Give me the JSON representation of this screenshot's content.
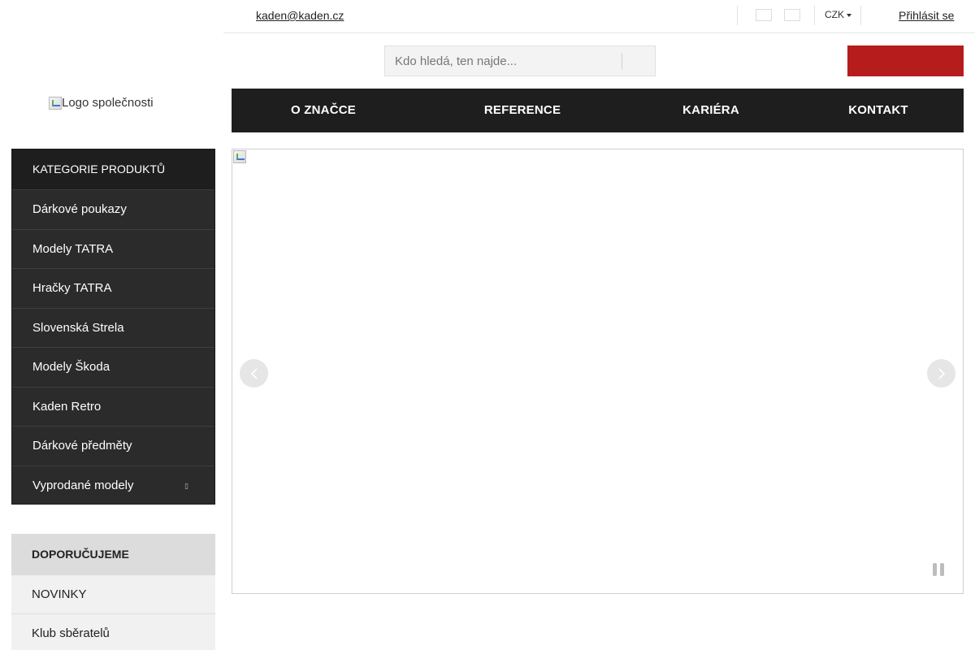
{
  "topbar": {
    "email": "kaden@kaden.cz",
    "currency": "CZK",
    "login": "Přihlásit se"
  },
  "logo": {
    "alt": "Logo společnosti"
  },
  "search": {
    "placeholder": "Kdo hledá, ten najde..."
  },
  "nav": {
    "items": [
      {
        "label": "O ZNAČCE"
      },
      {
        "label": "REFERENCE"
      },
      {
        "label": "KARIÉRA"
      },
      {
        "label": "KONTAKT"
      }
    ]
  },
  "categories": {
    "heading": "KATEGORIE PRODUKTŮ",
    "items": [
      {
        "label": "Dárkové poukazy"
      },
      {
        "label": "Modely TATRA"
      },
      {
        "label": "Hračky TATRA"
      },
      {
        "label": "Slovenská Strela"
      },
      {
        "label": "Modely Škoda"
      },
      {
        "label": "Kaden Retro"
      },
      {
        "label": "Dárkové předměty"
      },
      {
        "label": "Vyprodané modely"
      }
    ],
    "expand_icon": "expand-icon"
  },
  "recommend": {
    "heading": "DOPORUČUJEME",
    "items": [
      {
        "label": "NOVINKY"
      },
      {
        "label": "Klub sběratelů"
      }
    ]
  },
  "colors": {
    "nav_bg": "#1e1e1e",
    "sidebar_bg": "#2b2b2b",
    "accent_red": "#b71c1c"
  }
}
